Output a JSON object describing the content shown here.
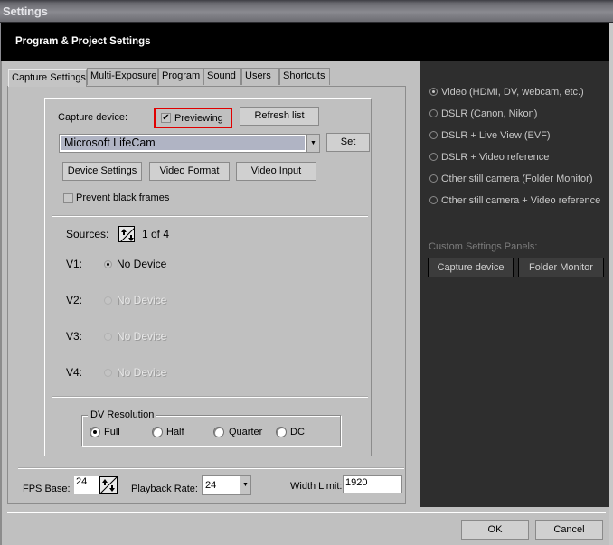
{
  "window": {
    "title": "Settings"
  },
  "header": {
    "title": "Program & Project Settings"
  },
  "tabs": [
    {
      "label": "Capture Settings",
      "active": true
    },
    {
      "label": "Multi-Exposure",
      "active": false
    },
    {
      "label": "Program",
      "active": false
    },
    {
      "label": "Sound",
      "active": false
    },
    {
      "label": "Users",
      "active": false
    },
    {
      "label": "Shortcuts",
      "active": false
    }
  ],
  "capture": {
    "device_label": "Capture device:",
    "previewing_label": "Previewing",
    "previewing_checked": true,
    "refresh_label": "Refresh list",
    "device_value": "Microsoft LifeCam",
    "set_label": "Set",
    "device_settings_label": "Device Settings",
    "video_format_label": "Video Format",
    "video_input_label": "Video Input",
    "prevent_black_label": "Prevent black frames",
    "prevent_black_checked": false,
    "highlight_color": "#e00000"
  },
  "sources": {
    "label": "Sources:",
    "count_text": "1 of 4",
    "rows": [
      {
        "name": "V1:",
        "device": "No Device",
        "selected": true,
        "enabled": true
      },
      {
        "name": "V2:",
        "device": "No Device",
        "selected": false,
        "enabled": false
      },
      {
        "name": "V3:",
        "device": "No Device",
        "selected": false,
        "enabled": false
      },
      {
        "name": "V4:",
        "device": "No Device",
        "selected": false,
        "enabled": false
      }
    ]
  },
  "dv_resolution": {
    "title": "DV Resolution",
    "options": [
      {
        "label": "Full",
        "selected": true
      },
      {
        "label": "Half",
        "selected": false
      },
      {
        "label": "Quarter",
        "selected": false
      },
      {
        "label": "DC",
        "selected": false
      }
    ]
  },
  "footer": {
    "fps_base_label": "FPS Base:",
    "fps_base_value": "24",
    "playback_rate_label": "Playback Rate:",
    "playback_rate_value": "24",
    "width_limit_label": "Width Limit:",
    "width_limit_value": "1920"
  },
  "camera_types": {
    "options": [
      {
        "label": "Video (HDMI, DV, webcam, etc.)",
        "selected": true
      },
      {
        "label": "DSLR (Canon, Nikon)",
        "selected": false
      },
      {
        "label": "DSLR + Live View (EVF)",
        "selected": false
      },
      {
        "label": "DSLR + Video reference",
        "selected": false
      },
      {
        "label": "Other still camera (Folder Monitor)",
        "selected": false
      },
      {
        "label": "Other still camera + Video reference",
        "selected": false
      }
    ],
    "custom_panels_label": "Custom Settings Panels:",
    "custom_buttons": [
      {
        "label": "Capture device"
      },
      {
        "label": "Folder Monitor"
      }
    ]
  },
  "dialog_buttons": {
    "ok_label": "OK",
    "cancel_label": "Cancel"
  }
}
